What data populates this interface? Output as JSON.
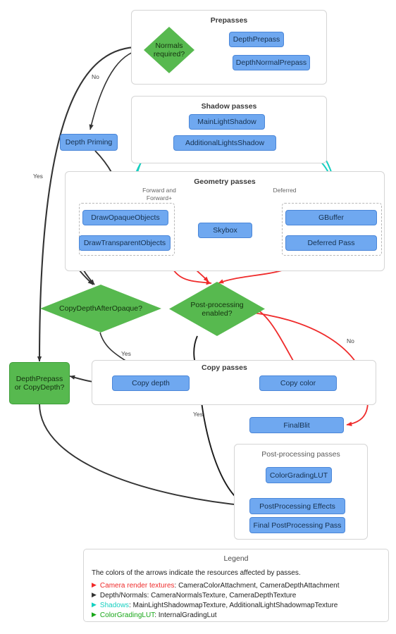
{
  "diagram": {
    "title": "URP Render Pass Flow"
  },
  "panels": {
    "prepasses": {
      "title": "Prepasses"
    },
    "shadow": {
      "title": "Shadow passes"
    },
    "geometry": {
      "title": "Geometry passes",
      "group_forward": "Forward and\nForward+",
      "group_forward_line1": "Forward and",
      "group_forward_line2": "Forward+",
      "group_deferred": "Deferred"
    },
    "copy": {
      "title": "Copy passes"
    },
    "postprocessing": {
      "title": "Post-processing passes"
    }
  },
  "nodes": {
    "depth_prepass": "DepthPrepass",
    "depth_normal_prepass": "DepthNormalPrepass",
    "normals_required": "Normals\nrequired?",
    "normals_required_l1": "Normals",
    "normals_required_l2": "required?",
    "main_light_shadow": "MainLightShadow",
    "additional_lights_shadow": "AdditionalLightsShadow",
    "depth_priming": "Depth Priming",
    "draw_opaque": "DrawOpaqueObjects",
    "draw_transparent": "DrawTransparentObjects",
    "skybox": "Skybox",
    "gbuffer": "GBuffer",
    "deferred_pass": "Deferred Pass",
    "copy_depth_after_opaque": "CopyDepthAfterOpaque?",
    "post_processing_enabled_l1": "Post-processing",
    "post_processing_enabled_l2": "enabled?",
    "depth_prepass_or_copydepth_l1": "DepthPrepass",
    "depth_prepass_or_copydepth_l2": "or CopyDepth?",
    "copy_depth": "Copy depth",
    "copy_color": "Copy color",
    "final_blit": "FinalBlit",
    "color_grading_lut": "ColorGradingLUT",
    "postprocessing_effects": "PostProcessing Effects",
    "final_postprocessing_pass": "Final PostProcessing Pass"
  },
  "edge_labels": {
    "no_prepass": "No",
    "yes_prepass": "Yes",
    "yes_copydepth": "Yes",
    "no_postprocess": "No",
    "yes_postprocess": "Yes"
  },
  "legend": {
    "title": "Legend",
    "intro": "The colors of the arrows indicate the resources affected by passes.",
    "rows": [
      {
        "marker": "▶",
        "key": "Camera render textures",
        "value": ": CameraColorAttachment, CameraDepthAttachment",
        "color": "#ef2b2b"
      },
      {
        "marker": "▶",
        "key": "Depth/Normals",
        "value": ": CameraNormalsTexture, CameraDepthTexture",
        "color": "#333333"
      },
      {
        "marker": "▶",
        "key": "Shadows",
        "value": ": MainLightShadowmapTexture, AdditionalLightShadowmapTexture",
        "color": "#16cfc0"
      },
      {
        "marker": "▶",
        "key": "ColorGradingLUT",
        "value": ": InternalGradingLut",
        "color": "#18a718"
      }
    ]
  },
  "colors": {
    "node_blue_fill": "#6fa8f0",
    "node_blue_border": "#4a86d8",
    "decision_green": "#57b94f",
    "arrow_depth_normals": "#333333",
    "arrow_camera_textures": "#ef2b2b",
    "arrow_shadows": "#16cfc0",
    "arrow_colorgrading": "#18a718",
    "panel_border": "#d5d5d5"
  }
}
